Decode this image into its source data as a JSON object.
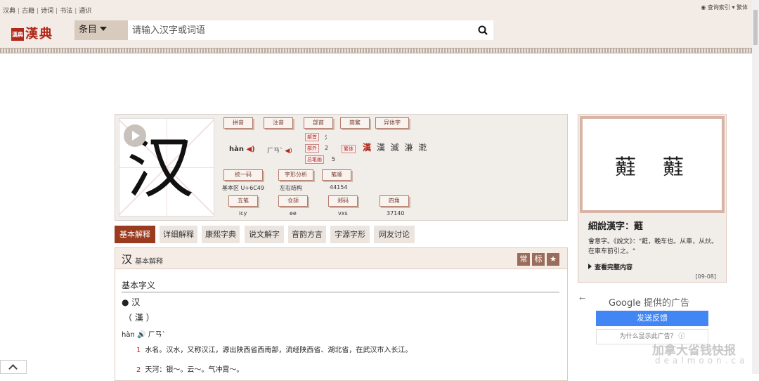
{
  "header": {
    "nav_links": [
      "汉典",
      "古籍",
      "诗词",
      "书法",
      "通识"
    ],
    "right_links": "◉ 查询索引 ▾ 繁体",
    "logo_seal": "漢典",
    "logo": "漢典",
    "category_select": "条目",
    "search_placeholder": "请输入汉字或词语"
  },
  "character": {
    "glyph": "汉",
    "tags": {
      "pinyin": "拼音",
      "zhuyin": "注音",
      "radical": "部首",
      "simp_trad": "简繁",
      "variants": "异体字",
      "unicode": "统一码",
      "structure_analysis": "字形分析",
      "strokes_order": "笔顺",
      "wubi": "五笔",
      "cangjie": "仓颉",
      "zhengma": "郑码",
      "sijiao": "四角"
    },
    "pinyin": "hàn",
    "zhuyin": "ㄏㄢˋ",
    "radical_label": "部首",
    "radical_value": "氵",
    "outer_strokes_label": "部外",
    "outer_strokes": "2",
    "total_strokes_label": "总笔画",
    "total_strokes": "5",
    "traditional_label": "繁体",
    "variant_chars_highlight": "漢",
    "variant_chars": "漢 滅 溓 漧",
    "unicode_value": "基本区 U+6C49",
    "structure_value": "左右结构",
    "strokes_order_value": "44154",
    "wubi_value": "icy",
    "cangjie_value": "ee",
    "zhengma_value": "vxs",
    "sijiao_value": "37140"
  },
  "tabs": [
    {
      "label": "基本解释",
      "active": true
    },
    {
      "label": "详细解释",
      "active": false
    },
    {
      "label": "康熙字典",
      "active": false
    },
    {
      "label": "说文解字",
      "active": false
    },
    {
      "label": "音韵方言",
      "active": false
    },
    {
      "label": "字源字形",
      "active": false
    },
    {
      "label": "网友讨论",
      "active": false
    }
  ],
  "panel": {
    "char": "汉",
    "subtitle": "基本解释",
    "buttons": [
      "常",
      "标",
      "★"
    ],
    "section_title": "基本字义",
    "bullet_char": "● 汉",
    "traditional": "（ 漢 ）",
    "pinyin_line": "hàn 🔊 ㄏㄢˋ",
    "definitions": [
      {
        "num": "1",
        "text": "水名。汉水，又称汉江，源出陕西省西南部，流经陕西省、湖北省，在武汉市入长江。"
      },
      {
        "num": "2",
        "text": "天河：银～。云～。气冲霄～。"
      }
    ]
  },
  "right_card": {
    "glyph_a": "蘳",
    "glyph_b": "蘳",
    "title": "細說漢字：蘳",
    "description": "會意字。《說文》：\"蘳，輓车也。从車，从炏。在車车前引之。\"",
    "more": "查看完整内容",
    "date": "[09-08]"
  },
  "ad": {
    "back": "←",
    "title": "Google",
    "title_suffix": "提供的广告",
    "feedback_button": "发送反馈",
    "why_button": "为什么显示此广告？ ⓘ"
  },
  "watermark": {
    "line1": "加拿大省钱快报",
    "line2": "dealmoon.ca"
  },
  "colors": {
    "accent": "#9a3b20",
    "brand_red": "#b3281b",
    "header_bg": "#f3ece6"
  }
}
